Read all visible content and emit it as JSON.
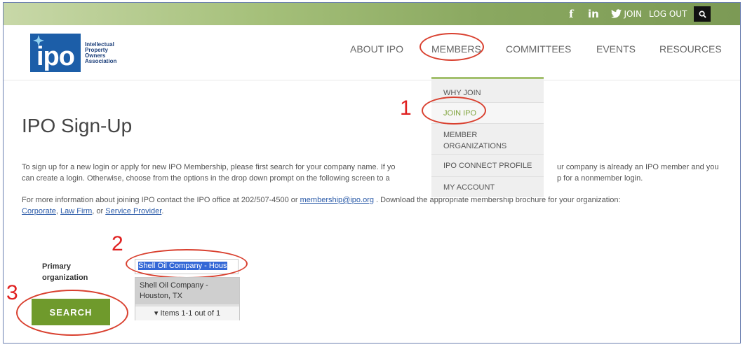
{
  "topbar": {
    "facebook_icon": "f",
    "linkedin_icon": "in",
    "twitter_icon": "twitter-icon",
    "join": "JOIN",
    "logout": "LOG OUT",
    "search_icon": "search-icon"
  },
  "logo": {
    "mark": "ipo",
    "words": [
      "Intellectual",
      "Property",
      "Owners",
      "Association"
    ]
  },
  "nav": {
    "items": [
      "ABOUT IPO",
      "MEMBERS",
      "COMMITTEES",
      "EVENTS",
      "RESOURCES"
    ]
  },
  "dropdown": {
    "items": [
      "WHY JOIN",
      "JOIN IPO",
      "MEMBER ORGANIZATIONS",
      "IPO CONNECT PROFILE",
      "MY ACCOUNT"
    ]
  },
  "annotations": {
    "n1": "1",
    "n2": "2",
    "n3": "3"
  },
  "page": {
    "title": "IPO Sign-Up",
    "para1_line1_left": "To sign up for a new login or apply for new IPO Membership, please first search for your company name. If yo",
    "para1_line1_right": "ur company is already an IPO member and you",
    "para1_line2_left": "can create a login. Otherwise, choose from the options in the drop down prompt on the following screen to a",
    "para1_line2_right": "p for a nonmember login.",
    "para2_text1": "For more information about joining IPO contact the IPO office at 202/507-4500 or ",
    "para2_email": "membership@ipo.org",
    "para2_text2": " . Download the appropriate membership brochure for your organization:",
    "link_corporate": "Corporate",
    "sep1": ", ",
    "link_lawfirm": "Law Firm",
    "sep2": ", or ",
    "link_provider": "Service Provider",
    "end": "."
  },
  "form": {
    "label": "Primary organization",
    "input_value": "Shell Oil Company - Hous",
    "suggestion": "Shell Oil Company - Houston, TX",
    "pager": "Items 1-1 out of 1",
    "search_button": "SEARCH"
  },
  "colors": {
    "accent_green": "#6f9a2c",
    "brand_blue": "#1c5ea8",
    "annotation_red": "#d9402f"
  }
}
